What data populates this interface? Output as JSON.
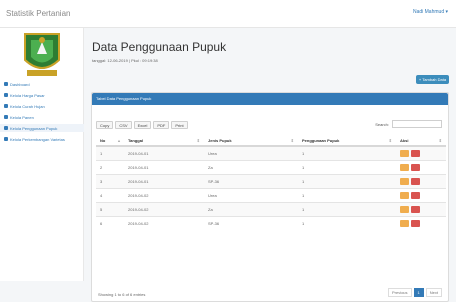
{
  "app": {
    "brand": "Statistik Pertanian",
    "user_menu": "Nadi Mahmud ▾"
  },
  "sidebar": {
    "items": [
      {
        "label": "Dashboard",
        "icon": "home-icon"
      },
      {
        "label": "Kelola Harga Pasar",
        "icon": "tag-icon"
      },
      {
        "label": "Kelola Curah Hujan",
        "icon": "cloud-icon"
      },
      {
        "label": "Kelola Panen",
        "icon": "chart-icon"
      },
      {
        "label": "Kelola Penggunaan Pupuk",
        "icon": "flask-icon"
      },
      {
        "label": "Kelola Perkembangan Varietas",
        "icon": "leaf-icon"
      }
    ],
    "active_index": 4
  },
  "main": {
    "title": "Data Penggunaan Pupuk",
    "date_line": "tanggal: 12-06-2019 | Pkul : 09:19:38",
    "add_button": "+ Tambah Data"
  },
  "panel": {
    "title": "Tabel Data Penggunaan Pupuk",
    "tools": [
      "Copy",
      "CSV",
      "Excel",
      "PDF",
      "Print"
    ],
    "search_label": "Search:",
    "columns": [
      "No",
      "Tanggal",
      "Jenis Pupuk",
      "Penggunaan Pupuk",
      "Aksi"
    ],
    "rows": [
      {
        "no": "1",
        "tanggal": "2019-04-01",
        "jenis": "Urea",
        "penggunaan": "1"
      },
      {
        "no": "2",
        "tanggal": "2019-04-01",
        "jenis": "Za",
        "penggunaan": "1"
      },
      {
        "no": "3",
        "tanggal": "2019-04-01",
        "jenis": "SP-36",
        "penggunaan": "1"
      },
      {
        "no": "4",
        "tanggal": "2019-04-02",
        "jenis": "Urea",
        "penggunaan": "1"
      },
      {
        "no": "5",
        "tanggal": "2019-04-02",
        "jenis": "Za",
        "penggunaan": "1"
      },
      {
        "no": "6",
        "tanggal": "2019-04-02",
        "jenis": "SP-36",
        "penggunaan": "1"
      }
    ],
    "showing": "Showing 1 to 6 of 6 entries",
    "pager": {
      "previous": "Previous",
      "current": "1",
      "next": "Next"
    }
  },
  "colors": {
    "primary": "#337ab7",
    "edit": "#f0ad4e",
    "delete": "#d9534f"
  }
}
